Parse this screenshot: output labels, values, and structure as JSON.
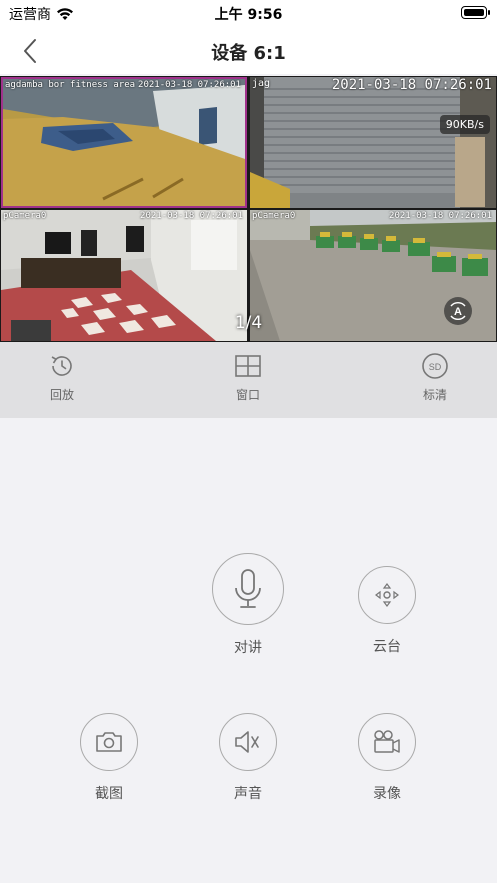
{
  "status_bar": {
    "carrier": "运营商",
    "time": "上午 9:56",
    "battery_level": 1.0
  },
  "nav": {
    "title": "设备 6:1"
  },
  "video": {
    "cameras": [
      {
        "osd_name": "agdamba bor fitness area",
        "osd_time": "2021-03-18 07:26:01"
      },
      {
        "osd_name": "jag",
        "osd_time": "2021-03-18  07:26:01",
        "speed": "90KB/s"
      },
      {
        "osd_name": "pCamera0",
        "osd_time": "2021-03-18 07:26:01"
      },
      {
        "osd_name": "pCamera0",
        "osd_time": "2021-03-18 07:26:01"
      }
    ],
    "page_indicator": "1/4"
  },
  "toolbar": {
    "playback_label": "回放",
    "window_label": "窗口",
    "quality_label": "标清",
    "quality_icon_text": "SD"
  },
  "controls": {
    "intercom_label": "对讲",
    "ptz_label": "云台",
    "screenshot_label": "截图",
    "sound_label": "声音",
    "record_label": "录像"
  },
  "colors": {
    "selected_border": "#a0328c",
    "toolbar_bg": "#e0e0e2",
    "page_bg": "#f2f2f5"
  }
}
